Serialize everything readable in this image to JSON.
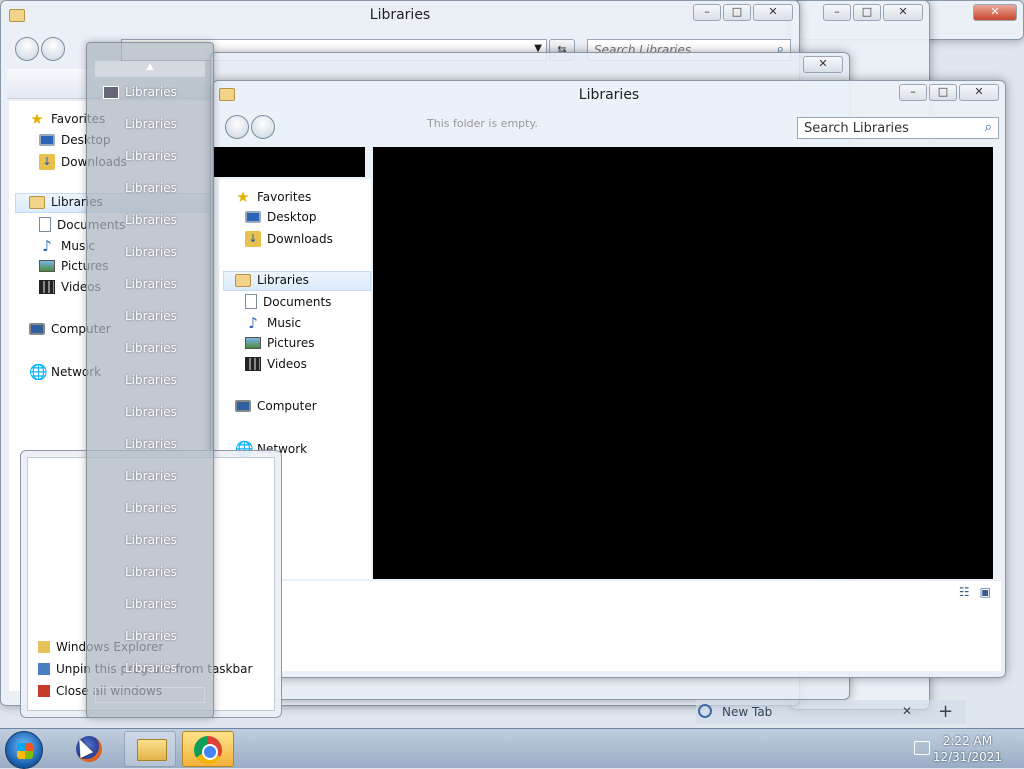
{
  "windows": {
    "back1": {
      "title": "Libraries",
      "search_placeholder": "Search Libraries"
    },
    "front": {
      "title": "Libraries",
      "search_placeholder": "Search Libraries",
      "empty_hint": "This folder is empty."
    }
  },
  "caption": {
    "minimize": "–",
    "maximize": "□",
    "close": "✕"
  },
  "nav_back": {
    "items": [
      {
        "label": "Favorites",
        "icon": "star-icon"
      },
      {
        "label": "Desktop",
        "icon": "desktop-icon"
      },
      {
        "label": "Downloads",
        "icon": "downloads-icon"
      },
      {
        "label": "Libraries",
        "icon": "libraries-icon"
      },
      {
        "label": "Documents",
        "icon": "documents-icon"
      },
      {
        "label": "Music",
        "icon": "music-icon"
      },
      {
        "label": "Pictures",
        "icon": "pictures-icon"
      },
      {
        "label": "Videos",
        "icon": "videos-icon"
      },
      {
        "label": "Computer",
        "icon": "computer-icon"
      },
      {
        "label": "Network",
        "icon": "network-icon"
      }
    ]
  },
  "nav_front": {
    "items": [
      {
        "label": "Favorites"
      },
      {
        "label": "Desktop"
      },
      {
        "label": "Downloads"
      },
      {
        "label": "Libraries"
      },
      {
        "label": "Documents"
      },
      {
        "label": "Music"
      },
      {
        "label": "Pictures"
      },
      {
        "label": "Videos"
      },
      {
        "label": "Computer"
      },
      {
        "label": "Network"
      }
    ]
  },
  "jumplist": {
    "items": [
      "Libraries",
      "Libraries",
      "Libraries",
      "Libraries",
      "Libraries",
      "Libraries",
      "Libraries",
      "Libraries",
      "Libraries",
      "Libraries",
      "Libraries",
      "Libraries",
      "Libraries",
      "Libraries",
      "Libraries",
      "Libraries",
      "Libraries",
      "Libraries",
      "Libraries"
    ]
  },
  "context_menu": {
    "items": [
      {
        "label": "Windows Explorer"
      },
      {
        "label": "Unpin this program from taskbar"
      },
      {
        "label": "Close all windows"
      }
    ]
  },
  "browser": {
    "tab_label": "New Tab",
    "new_tab": "+"
  },
  "taskbar": {
    "time": "2:22 AM",
    "date": "12/31/2021"
  }
}
